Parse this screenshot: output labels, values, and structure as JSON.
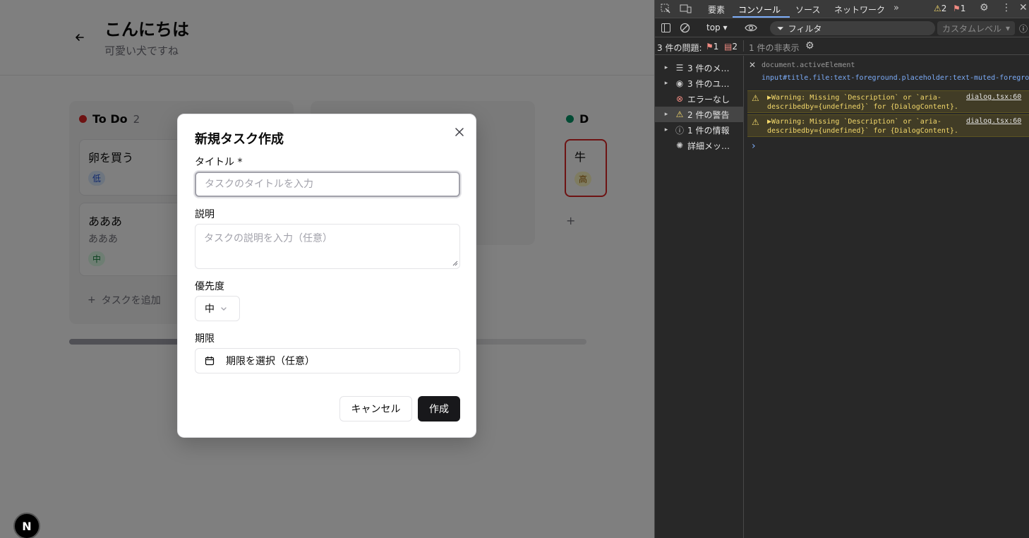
{
  "app": {
    "title": "こんにちは",
    "subtitle": "可愛い犬ですね",
    "columns": [
      {
        "name": "To Do",
        "count": "2",
        "color": "#dc2626"
      },
      {
        "name": "D",
        "color": "#059669"
      }
    ],
    "cards": [
      {
        "title": "卵を買う",
        "priority": "低"
      },
      {
        "title": "あああ",
        "description": "あああ",
        "priority": "中"
      }
    ],
    "done_card": {
      "title": "牛",
      "priority": "高"
    },
    "add_task_label": "タスクを追加",
    "next_badge": "N"
  },
  "dialog": {
    "title": "新規タスク作成",
    "title_label": "タイトル *",
    "title_placeholder": "タスクのタイトルを入力",
    "description_label": "説明",
    "description_placeholder": "タスクの説明を入力（任意）",
    "priority_label": "優先度",
    "priority_value": "中",
    "due_label": "期限",
    "due_placeholder": "期限を選択（任意）",
    "cancel_label": "キャンセル",
    "create_label": "作成"
  },
  "devtools": {
    "tabs": [
      "要素",
      "コンソール",
      "ソース",
      "ネットワーク"
    ],
    "warn_count": "2",
    "error_count": "1",
    "context": "top",
    "filter_label": "フィルタ",
    "levels_label": "カスタムレベル",
    "issues_label": "3 件の問題:",
    "issues_error_count": "1",
    "issues_info_count": "2",
    "hidden_label": "1 件の非表示",
    "sidebar": [
      {
        "label": "3 件のメ…"
      },
      {
        "label": "3 件のユ…"
      },
      {
        "label": "エラーなし"
      },
      {
        "label": "2 件の警告"
      },
      {
        "label": "1 件の情報"
      },
      {
        "label": "詳細メッ…"
      }
    ],
    "live_expression": "document.activeElement",
    "live_value": "input#title.file:text-foreground.placeholder:text-muted-foreground.se",
    "warnings": [
      {
        "text": "▶Warning: Missing `Description` or `aria-describedby={undefined}` for {DialogContent}.",
        "source": "dialog.tsx:60"
      },
      {
        "text": "▶Warning: Missing `Description` or `aria-describedby={undefined}` for {DialogContent}.",
        "source": "dialog.tsx:60"
      }
    ],
    "prompt": "›"
  }
}
